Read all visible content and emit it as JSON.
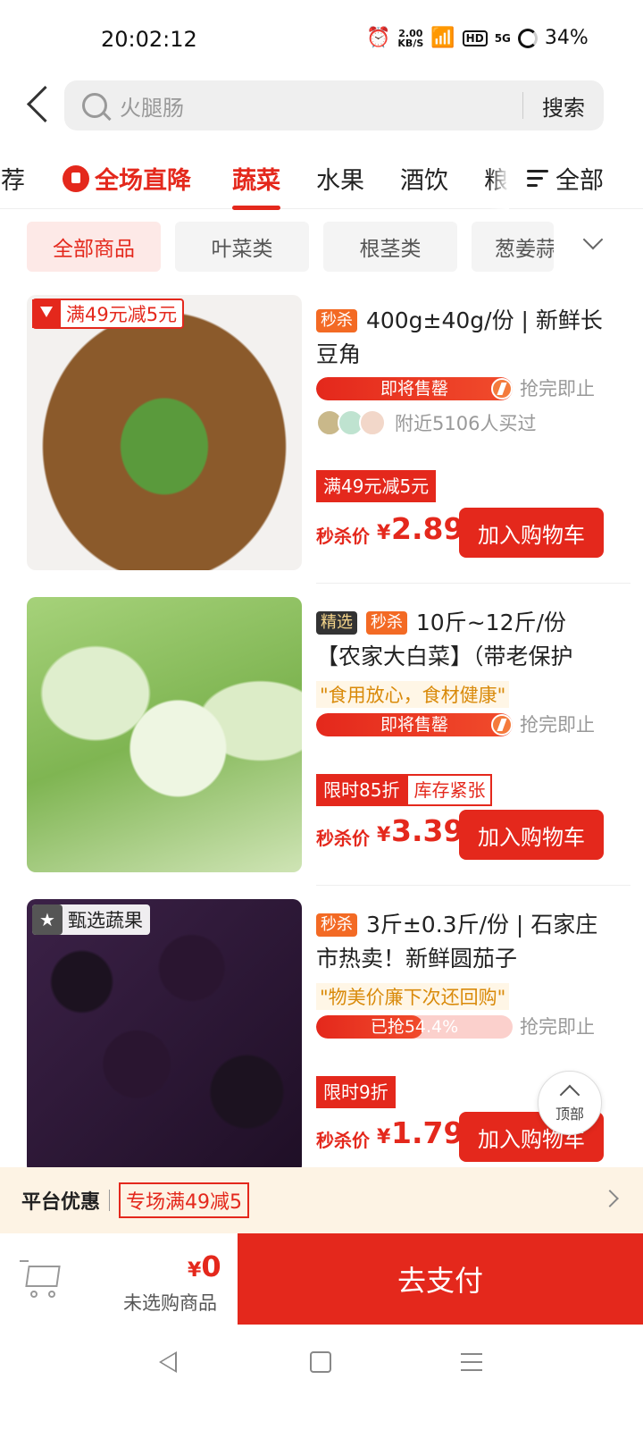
{
  "status_bar": {
    "time": "20:02:12",
    "speed_value": "2.00",
    "speed_unit": "KB/S",
    "hd": "HD",
    "network": "5G",
    "battery": "34%"
  },
  "search": {
    "placeholder": "火腿肠",
    "button": "搜索"
  },
  "tabs": {
    "items": [
      "推荐",
      "全场直降",
      "蔬菜",
      "水果",
      "酒饮",
      "粮"
    ],
    "active": "蔬菜",
    "all_label": "全部"
  },
  "chips": {
    "items": [
      "全部商品",
      "叶菜类",
      "根茎类",
      "葱姜蒜"
    ],
    "active": "全部商品"
  },
  "products": [
    {
      "badges": [
        "秒杀"
      ],
      "title": "400g±40g/份 | 新鲜长豆角",
      "image_tag": "满49元减5元",
      "progress_text": "即将售罄",
      "progress": 1.0,
      "hint": "抢完即止",
      "buyers_text": "附近5106人买过",
      "coupons": [
        "满49元减5元"
      ],
      "price_label": "秒杀价",
      "currency": "¥",
      "price": "2.89",
      "add_label": "加入购物车"
    },
    {
      "badges": [
        "精选",
        "秒杀"
      ],
      "title": "10斤~12斤/份【农家大白菜】（带老保护",
      "slogan": "\"食用放心，食材健康\"",
      "progress_text": "即将售罄",
      "progress": 1.0,
      "hint": "抢完即止",
      "coupons": [
        "限时85折",
        "库存紧张"
      ],
      "price_label": "秒杀价",
      "currency": "¥",
      "price": "3.39",
      "add_label": "加入购物车"
    },
    {
      "badges": [
        "秒杀"
      ],
      "title": "3斤±0.3斤/份 | 石家庄市热卖！新鲜圆茄子",
      "image_tag": "甄选蔬果",
      "slogan": "\"物美价廉下次还回购\"",
      "progress_text": "已抢54.4%",
      "progress": 0.544,
      "hint": "抢完即止",
      "coupons": [
        "限时9折"
      ],
      "price_label": "秒杀价",
      "currency": "¥",
      "price": "1.79",
      "add_label": "加入购物车"
    }
  ],
  "back_to_top": "顶部",
  "platform": {
    "title": "平台优惠",
    "coupon": "专场满49减5"
  },
  "cart": {
    "currency": "¥",
    "total": "0",
    "status": "未选购商品",
    "pay_label": "去支付"
  },
  "colors": {
    "accent": "#e4281c",
    "seckill_badge": "#f36a24",
    "platform_bg": "#fdf3e4"
  }
}
